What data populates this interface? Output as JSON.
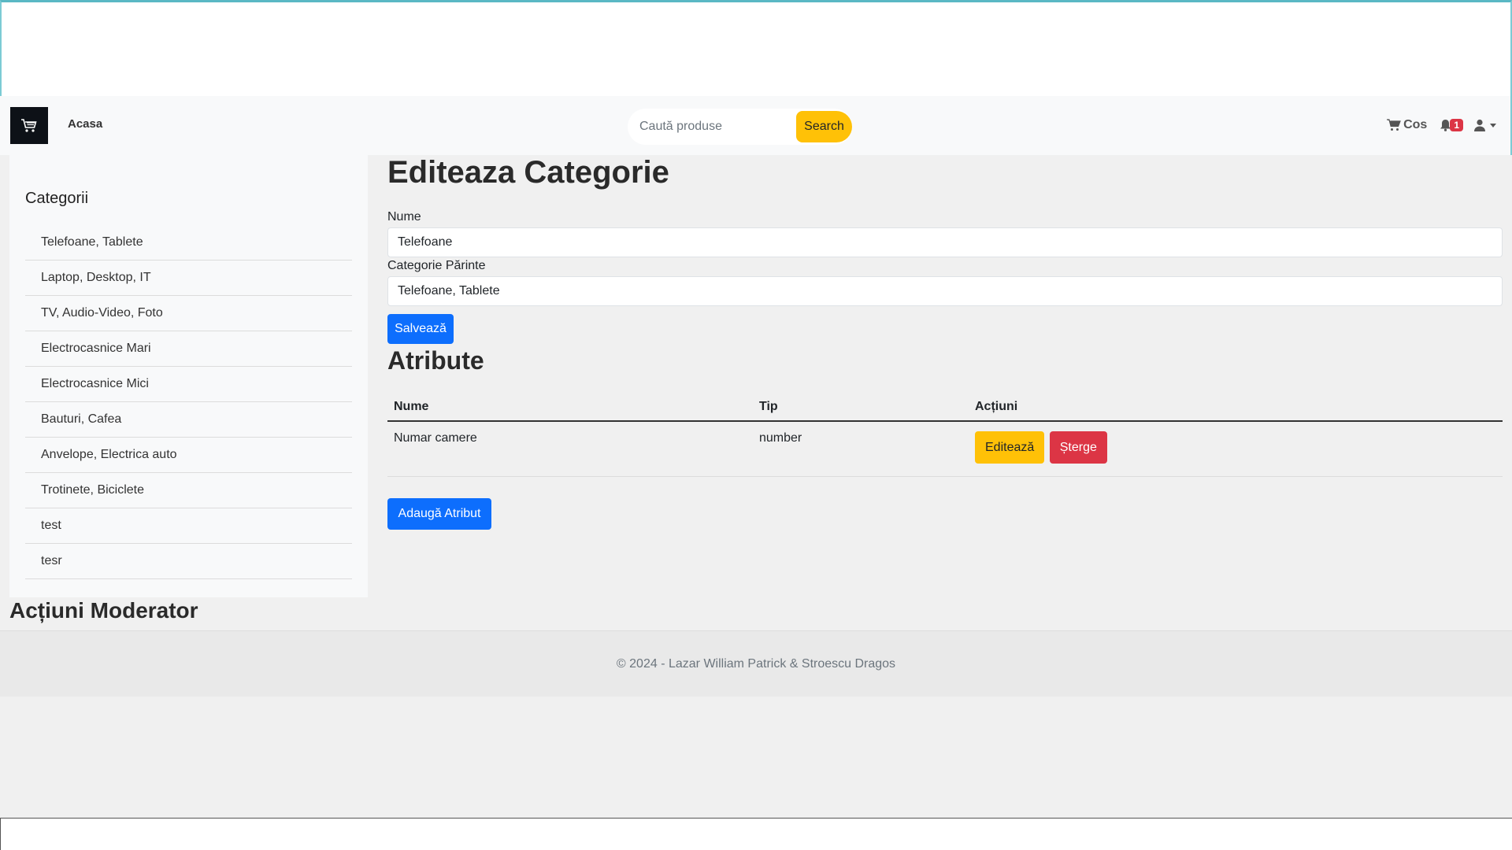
{
  "navbar": {
    "home_label": "Acasa",
    "search_placeholder": "Caută produse",
    "search_button": "Search",
    "cart_label": "Cos",
    "notification_count": "1"
  },
  "sidebar": {
    "title": "Categorii",
    "items": [
      "Telefoane, Tablete",
      "Laptop, Desktop, IT",
      "TV, Audio-Video, Foto",
      "Electrocasnice Mari",
      "Electrocasnice Mici",
      "Bauturi, Cafea",
      "Anvelope, Electrica auto",
      "Trotinete, Biciclete",
      "test",
      "tesr"
    ]
  },
  "main": {
    "title": "Editeaza Categorie",
    "name_label": "Nume",
    "name_value": "Telefoane",
    "parent_label": "Categorie Părinte",
    "parent_value": "Telefoane, Tablete",
    "save_button": "Salvează",
    "attributes_title": "Atribute",
    "table": {
      "headers": [
        "Nume",
        "Tip",
        "Acțiuni"
      ],
      "rows": [
        {
          "name": "Numar camere",
          "type": "number",
          "edit": "Editează",
          "delete": "Șterge"
        }
      ]
    },
    "add_attribute_button": "Adaugă Atribut"
  },
  "moderator": {
    "title": "Acțiuni Moderator"
  },
  "footer": {
    "text": "© 2024 - Lazar William Patrick & Stroescu Dragos"
  },
  "colors": {
    "primary": "#0d6efd",
    "warning": "#ffc107",
    "danger": "#dc3545"
  }
}
